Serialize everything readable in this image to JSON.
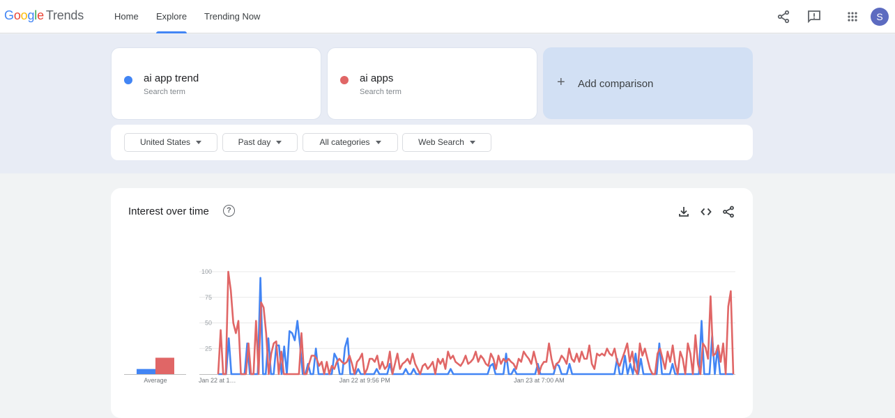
{
  "header": {
    "logo": {
      "google": [
        "G",
        "o",
        "o",
        "g",
        "l",
        "e"
      ],
      "product": "Trends"
    },
    "nav": [
      {
        "label": "Home",
        "active": false
      },
      {
        "label": "Explore",
        "active": true
      },
      {
        "label": "Trending Now",
        "active": false
      }
    ],
    "icons": [
      "share-icon",
      "feedback-icon",
      "apps-grid-icon"
    ],
    "avatar_initial": "S"
  },
  "search_terms": [
    {
      "term": "ai app trend",
      "sublabel": "Search term",
      "color": "#4285f4"
    },
    {
      "term": "ai apps",
      "sublabel": "Search term",
      "color": "#e06666"
    }
  ],
  "add_comparison": {
    "icon": "+",
    "label": "Add comparison"
  },
  "filters": [
    {
      "label": "United States"
    },
    {
      "label": "Past day"
    },
    {
      "label": "All categories"
    },
    {
      "label": "Web Search"
    }
  ],
  "interest_card": {
    "title": "Interest over time",
    "help_icon": "?",
    "actions": [
      "download-icon",
      "embed-icon",
      "share-icon"
    ]
  },
  "chart_data": {
    "type": "line",
    "title": "Interest over time",
    "xlabel": "",
    "ylabel": "",
    "ylim": [
      0,
      100
    ],
    "yticks": [
      25,
      50,
      75,
      100
    ],
    "grid": true,
    "x_tick_labels": [
      {
        "label": "Jan 22 at 1…",
        "index": 0
      },
      {
        "label": "Jan 22 at 9:56 PM",
        "index": 56
      },
      {
        "label": "Jan 23 at 7:00 AM",
        "index": 122
      }
    ],
    "averages": {
      "label": "Average",
      "values": [
        5,
        16
      ]
    },
    "series": [
      {
        "name": "ai app trend",
        "color": "#4285f4",
        "values": [
          0,
          0,
          0,
          0,
          35,
          0,
          0,
          0,
          0,
          0,
          0,
          30,
          0,
          0,
          0,
          0,
          94,
          0,
          0,
          35,
          0,
          0,
          28,
          28,
          0,
          27,
          0,
          42,
          40,
          33,
          52,
          28,
          0,
          0,
          10,
          0,
          0,
          25,
          0,
          0,
          0,
          0,
          0,
          0,
          20,
          15,
          0,
          0,
          26,
          35,
          0,
          0,
          0,
          5,
          0,
          0,
          0,
          0,
          0,
          0,
          5,
          0,
          0,
          0,
          0,
          10,
          0,
          0,
          0,
          0,
          0,
          5,
          0,
          0,
          5,
          0,
          0,
          0,
          0,
          0,
          0,
          0,
          0,
          0,
          0,
          0,
          0,
          0,
          5,
          0,
          0,
          0,
          0,
          0,
          0,
          0,
          0,
          0,
          0,
          0,
          0,
          0,
          0,
          8,
          10,
          0,
          0,
          0,
          0,
          20,
          0,
          0,
          5,
          0,
          0,
          0,
          0,
          0,
          0,
          0,
          0,
          10,
          0,
          0,
          0,
          0,
          0,
          0,
          10,
          8,
          0,
          0,
          0,
          10,
          0,
          0,
          0,
          0,
          0,
          0,
          0,
          0,
          0,
          0,
          0,
          0,
          0,
          0,
          0,
          0,
          0,
          15,
          0,
          0,
          18,
          0,
          10,
          0,
          20,
          0,
          15,
          0,
          0,
          0,
          0,
          0,
          0,
          30,
          0,
          0,
          0,
          0,
          10,
          0,
          0,
          0,
          0,
          0,
          0,
          0,
          0,
          0,
          0,
          52,
          0,
          0,
          0,
          38,
          0,
          25,
          0,
          0,
          0,
          0,
          0,
          0
        ],
        "notes": "approximate, read from line shape"
      },
      {
        "name": "ai apps",
        "color": "#e06666",
        "values": [
          0,
          43,
          0,
          0,
          100,
          82,
          50,
          40,
          52,
          0,
          0,
          0,
          30,
          0,
          0,
          52,
          0,
          70,
          65,
          40,
          0,
          20,
          30,
          32,
          0,
          22,
          0,
          0,
          0,
          0,
          0,
          0,
          0,
          40,
          0,
          0,
          10,
          18,
          18,
          15,
          8,
          12,
          0,
          12,
          0,
          8,
          5,
          12,
          15,
          12,
          10,
          12,
          18,
          10,
          0,
          12,
          15,
          20,
          0,
          5,
          15,
          15,
          12,
          18,
          5,
          12,
          5,
          8,
          22,
          0,
          10,
          20,
          5,
          10,
          12,
          15,
          10,
          20,
          10,
          5,
          0,
          8,
          10,
          5,
          8,
          12,
          0,
          15,
          10,
          15,
          5,
          22,
          15,
          18,
          12,
          10,
          8,
          12,
          18,
          10,
          12,
          15,
          22,
          12,
          18,
          15,
          10,
          8,
          20,
          15,
          5,
          18,
          10,
          15,
          12,
          15,
          12,
          10,
          5,
          15,
          12,
          22,
          18,
          15,
          10,
          22,
          12,
          0,
          8,
          12,
          12,
          30,
          15,
          5,
          10,
          12,
          18,
          15,
          10,
          25,
          15,
          12,
          20,
          12,
          22,
          15,
          15,
          28,
          10,
          5,
          20,
          18,
          20,
          18,
          25,
          20,
          18,
          25,
          12,
          8,
          15,
          22,
          30,
          12,
          22,
          5,
          0,
          30,
          18,
          25,
          15,
          5,
          0,
          0,
          20,
          25,
          15,
          5,
          22,
          12,
          28,
          10,
          0,
          22,
          15,
          0,
          30,
          20,
          0,
          38,
          10,
          0,
          30,
          26,
          15,
          76,
          18,
          20,
          28,
          12,
          30,
          0,
          66,
          81,
          0
        ]
      }
    ]
  }
}
